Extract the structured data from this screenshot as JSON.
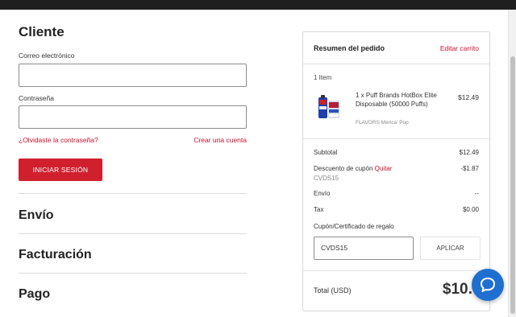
{
  "customer": {
    "title": "Cliente",
    "email_label": "Correo electrónico",
    "email_value": "",
    "password_label": "Contraseña",
    "password_value": "",
    "forgot_link": "¿Olvidaste la contraseña?",
    "create_link": "Crear una cuenta",
    "login_button": "INICIAR SESIÓN"
  },
  "sections": {
    "shipping": "Envío",
    "billing": "Facturación",
    "payment": "Pago"
  },
  "summary": {
    "title": "Resumen del pedido",
    "edit_link": "Editar carrito",
    "items_count": "1 Item",
    "product": {
      "name": "1 x Puff Brands HotBox Elite Disposable (50000 Puffs)",
      "price": "$12.49",
      "option": "FLAVORS Merica' Pop"
    },
    "subtotal_label": "Subtotal",
    "subtotal_value": "$12.49",
    "discount_label": "Descuento de cupón",
    "discount_remove": "Quitar",
    "discount_code": "CVDS15",
    "discount_value": "-$1.87",
    "shipping_label": "Envío",
    "shipping_value": "--",
    "tax_label": "Tax",
    "tax_value": "$0.00",
    "coupon_label": "Cupón/Certificado de regalo",
    "coupon_value": "CVDS15",
    "coupon_button": "APLICAR",
    "total_label": "Total (USD)",
    "total_value": "$10.62"
  },
  "colors": {
    "accent": "#c8102e",
    "button": "#d0202e",
    "chat": "#1f6fd0"
  },
  "icons": {
    "chat": "chat-bubble-icon"
  }
}
